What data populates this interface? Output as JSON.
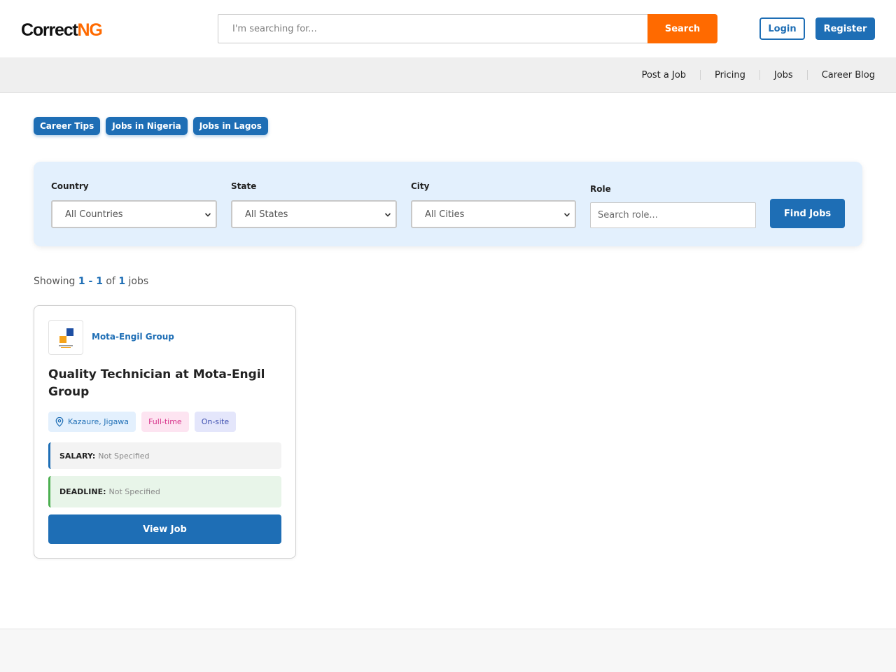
{
  "brand": {
    "logo_text_dark": "Correct",
    "logo_text_accent": "NG",
    "accent_color": "#ff6a00",
    "primary_color": "#1e6eb5"
  },
  "header": {
    "search_placeholder": "I'm searching for...",
    "search_button": "Search",
    "login_label": "Login",
    "register_label": "Register"
  },
  "nav": {
    "items": [
      "Post a Job",
      "Pricing",
      "Jobs",
      "Career Blog"
    ]
  },
  "tags": [
    "Career Tips",
    "Jobs in Nigeria",
    "Jobs in Lagos"
  ],
  "filters": {
    "country_label": "Country",
    "country_value": "All Countries",
    "state_label": "State",
    "state_value": "All States",
    "city_label": "City",
    "city_value": "All Cities",
    "role_label": "Role",
    "role_placeholder": "Search role...",
    "find_button": "Find Jobs"
  },
  "results": {
    "prefix": "Showing",
    "range": "1 - 1",
    "of": "of",
    "total": "1",
    "suffix": "jobs"
  },
  "jobs": [
    {
      "company": "Mota-Engil Group",
      "logo_icon": "mota-engil-logo",
      "title": "Quality Technician at Mota-Engil Group",
      "location": "Kazaure, Jigawa",
      "type": "Full-time",
      "mode": "On-site",
      "salary_label": "SALARY:",
      "salary_value": "Not Specified",
      "deadline_label": "DEADLINE:",
      "deadline_value": "Not Specified",
      "view_button": "View Job"
    }
  ]
}
